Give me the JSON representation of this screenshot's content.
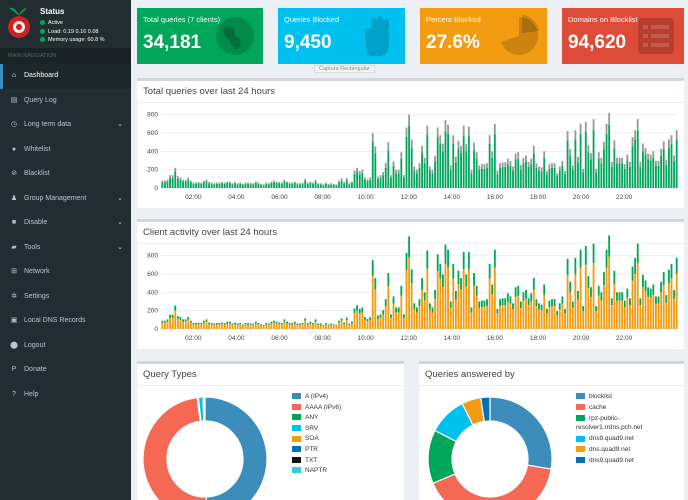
{
  "sidebar": {
    "status": {
      "title": "Status",
      "active": "Active",
      "load": "Load:  0.19  0.16  0.08",
      "memory": "Memory usage:  60.8 %"
    },
    "nav_header": "MAIN NAVIGATION",
    "items": [
      {
        "label": "Dashboard",
        "icon": "home-icon",
        "glyph": "⌂",
        "active": true,
        "chev": false
      },
      {
        "label": "Query Log",
        "icon": "file-icon",
        "glyph": "▤",
        "chev": false
      },
      {
        "label": "Long term data",
        "icon": "clock-icon",
        "glyph": "◷",
        "chev": true
      },
      {
        "label": "Whitelist",
        "icon": "check-circle-icon",
        "glyph": "●",
        "chev": false
      },
      {
        "label": "Blacklist",
        "icon": "ban-icon",
        "glyph": "⊘",
        "chev": false
      },
      {
        "label": "Group Management",
        "icon": "users-icon",
        "glyph": "♟",
        "chev": true
      },
      {
        "label": "Disable",
        "icon": "stop-icon",
        "glyph": "■",
        "chev": true
      },
      {
        "label": "Tools",
        "icon": "folder-icon",
        "glyph": "▰",
        "chev": true
      },
      {
        "label": "Network",
        "icon": "network-icon",
        "glyph": "⊞",
        "chev": false
      },
      {
        "label": "Settings",
        "icon": "gears-icon",
        "glyph": "✲",
        "chev": false
      },
      {
        "label": "Local DNS Records",
        "icon": "address-book-icon",
        "glyph": "▣",
        "chev": false
      },
      {
        "label": "Logout",
        "icon": "user-icon",
        "glyph": "⬤",
        "chev": false
      },
      {
        "label": "Donate",
        "icon": "paypal-icon",
        "glyph": "P",
        "chev": false
      },
      {
        "label": "Help",
        "icon": "question-icon",
        "glyph": "?",
        "chev": false
      }
    ],
    "chevron_glyph": "⌄"
  },
  "tiles": [
    {
      "label": "Total queries (7 clients)",
      "value": "34,181",
      "color": "#00a65a",
      "icon": "globe-icon"
    },
    {
      "label": "Queries Blocked",
      "value": "9,450",
      "color": "#00c0ef",
      "icon": "hand-icon"
    },
    {
      "label": "Percent Blocked",
      "value": "27.6%",
      "color": "#f39c12",
      "icon": "pie-chart-icon"
    },
    {
      "label": "Domains on Blocklist",
      "value": "94,620",
      "color": "#dd4b39",
      "icon": "list-icon"
    }
  ],
  "tooltip": "Captura Rectangular",
  "total_queries": {
    "title": "Total queries over last 24 hours",
    "colors": {
      "permitted": "#00a65a",
      "blocked": "#999999"
    }
  },
  "client_activity": {
    "title": "Client activity over last 24 hours",
    "colors": [
      "#f39c12",
      "#00a65a",
      "#dd4b39",
      "#3c8dbc",
      "#00c0ef",
      "#111111"
    ]
  },
  "query_types": {
    "title": "Query Types",
    "legend": [
      {
        "label": "A (IPv4)",
        "color": "#3c8dbc"
      },
      {
        "label": "AAAA (IPv6)",
        "color": "#f56954"
      },
      {
        "label": "ANY",
        "color": "#00a65a"
      },
      {
        "label": "SRV",
        "color": "#00c0ef"
      },
      {
        "label": "SOA",
        "color": "#f39c12"
      },
      {
        "label": "PTR",
        "color": "#0073b7"
      },
      {
        "label": "TXT",
        "color": "#111111"
      },
      {
        "label": "NAPTR",
        "color": "#39cccc"
      }
    ]
  },
  "queries_answered": {
    "title": "Queries answered by",
    "legend": [
      {
        "label": "blocklist",
        "color": "#3c8dbc"
      },
      {
        "label": "cache",
        "color": "#f56954"
      },
      {
        "label": "rpz-public-resolver1.rrdns.pch.net",
        "color": "#00a65a"
      },
      {
        "label": "dns9.quad9.net",
        "color": "#00c0ef"
      },
      {
        "label": "dns.quad9.net",
        "color": "#f39c12"
      },
      {
        "label": "dns9.quad9.net",
        "color": "#0073b7"
      }
    ]
  },
  "chart_data": [
    {
      "type": "bar",
      "title": "Total queries over last 24 hours",
      "x_tick_labels": [
        "02:00",
        "04:00",
        "06:00",
        "08:00",
        "10:00",
        "12:00",
        "14:00",
        "16:00",
        "18:00",
        "20:00",
        "22:00"
      ],
      "y_ticks": [
        0,
        200,
        400,
        600,
        800
      ],
      "ylim": [
        0,
        850
      ],
      "grid": true,
      "stacked": true,
      "series": [
        {
          "values": [
            60,
            60,
            70,
            110,
            110,
            180,
            100,
            90,
            70,
            70,
            90,
            60,
            45,
            45,
            50,
            45,
            60,
            70,
            50,
            45,
            40,
            45,
            45,
            50,
            45,
            55,
            55,
            40,
            50,
            40,
            45,
            35,
            45,
            45,
            40,
            40,
            55,
            45,
            35,
            30,
            45,
            40,
            55,
            60,
            55,
            50,
            45,
            70,
            55,
            45,
            45,
            55,
            40,
            40,
            45,
            80,
            45,
            55,
            45,
            70,
            40,
            40,
            30,
            45,
            35,
            40,
            35,
            30,
            60,
            80,
            50,
            85,
            40,
            55,
            155,
            180,
            150,
            160,
            90,
            75,
            90,
            510,
            380,
            100,
            110,
            140,
            220,
            410,
            110,
            240,
            160,
            160,
            320,
            110,
            560,
            680,
            440,
            190,
            160,
            220,
            380,
            270,
            580,
            190,
            160,
            290,
            550,
            480,
            400,
            620,
            590,
            200,
            480,
            280,
            430,
            380,
            570,
            400,
            570,
            160,
            410,
            320,
            200,
            210,
            210,
            220,
            480,
            330,
            590,
            150,
            220,
            230,
            230,
            260,
            240,
            190,
            310,
            320,
            200,
            270,
            290,
            230,
            260,
            380,
            220,
            190,
            180,
            330,
            150,
            210,
            220,
            220,
            130,
            190,
            240,
            150,
            520,
            350,
            200,
            530,
            280,
            590,
            170,
            610,
            390,
            310,
            630,
            170,
            320,
            270,
            420,
            590,
            690,
            230,
            430,
            270,
            270,
            270,
            210,
            300,
            230,
            460,
            530,
            630,
            230,
            400,
            360,
            310,
            300,
            330,
            240,
            240,
            350,
            420,
            250,
            440,
            480,
            290,
            530
          ]
        },
        {
          "values": [
            20,
            20,
            20,
            30,
            30,
            40,
            30,
            25,
            20,
            20,
            25,
            20,
            15,
            15,
            15,
            15,
            20,
            20,
            15,
            15,
            12,
            15,
            15,
            15,
            15,
            15,
            15,
            12,
            15,
            12,
            15,
            10,
            15,
            15,
            12,
            12,
            15,
            15,
            10,
            10,
            15,
            12,
            15,
            20,
            15,
            15,
            15,
            20,
            15,
            15,
            15,
            15,
            12,
            12,
            15,
            20,
            15,
            15,
            15,
            20,
            12,
            12,
            10,
            15,
            10,
            12,
            10,
            10,
            20,
            25,
            15,
            25,
            12,
            15,
            35,
            40,
            35,
            40,
            25,
            20,
            25,
            90,
            75,
            25,
            30,
            35,
            50,
            90,
            30,
            50,
            40,
            40,
            70,
            30,
            100,
            120,
            90,
            45,
            40,
            50,
            80,
            60,
            100,
            45,
            40,
            60,
            110,
            95,
            85,
            120,
            100,
            50,
            95,
            60,
            85,
            80,
            110,
            80,
            100,
            40,
            85,
            70,
            45,
            50,
            50,
            50,
            95,
            70,
            110,
            40,
            50,
            50,
            50,
            60,
            55,
            45,
            65,
            70,
            50,
            60,
            65,
            55,
            60,
            80,
            50,
            45,
            45,
            70,
            35,
            50,
            50,
            50,
            30,
            45,
            55,
            35,
            100,
            75,
            45,
            100,
            60,
            110,
            40,
            110,
            80,
            70,
            120,
            40,
            70,
            60,
            85,
            110,
            130,
            55,
            90,
            60,
            60,
            60,
            50,
            65,
            55,
            95,
            100,
            120,
            55,
            85,
            75,
            65,
            65,
            70,
            55,
            55,
            75,
            90,
            55,
            90,
            95,
            65,
            100
          ]
        }
      ]
    },
    {
      "type": "bar",
      "title": "Client activity over last 24 hours",
      "x_tick_labels": [
        "02:00",
        "04:00",
        "06:00",
        "08:00",
        "10:00",
        "12:00",
        "14:00",
        "16:00",
        "18:00",
        "20:00",
        "22:00"
      ],
      "y_ticks": [
        0,
        200,
        400,
        600,
        800
      ],
      "ylim": [
        0,
        850
      ],
      "grid": true,
      "stacked": true,
      "series": [
        {
          "values": [
            70,
            70,
            80,
            120,
            120,
            200,
            110,
            100,
            80,
            80,
            100,
            70,
            50,
            50,
            55,
            50,
            70,
            80,
            55,
            50,
            45,
            50,
            50,
            55,
            50,
            60,
            60,
            45,
            55,
            45,
            50,
            40,
            50,
            50,
            45,
            45,
            60,
            50,
            40,
            35,
            50,
            45,
            60,
            70,
            60,
            55,
            50,
            80,
            60,
            50,
            50,
            60,
            45,
            45,
            50,
            90,
            50,
            60,
            50,
            80,
            45,
            45,
            35,
            50,
            40,
            45,
            40,
            35,
            70,
            90,
            55,
            95,
            45,
            60,
            175,
            200,
            170,
            180,
            100,
            85,
            100,
            580,
            430,
            110,
            125,
            160,
            250,
            470,
            125,
            275,
            180,
            180,
            365,
            125,
            640,
            780,
            500,
            215,
            180,
            250,
            430,
            310,
            660,
            215,
            180,
            330,
            630,
            550,
            460,
            710,
            670,
            230,
            550,
            320,
            490,
            430,
            650,
            460,
            650,
            180,
            470,
            365,
            230,
            240,
            240,
            250,
            550,
            375,
            670,
            170,
            250,
            260,
            260,
            300,
            275,
            215,
            350,
            365,
            230,
            310,
            330,
            260,
            300,
            430,
            250,
            215,
            205,
            375,
            170,
            240,
            250,
            250,
            150,
            215,
            275,
            170,
            590,
            400,
            230,
            600,
            320,
            670,
            195,
            700,
            445,
            350,
            720,
            195,
            365,
            310,
            480,
            670,
            790,
            260,
            490,
            310,
            310,
            310,
            240,
            340,
            260,
            525,
            600,
            720,
            260,
            455,
            410,
            350,
            340,
            375,
            275,
            275,
            400,
            480,
            285,
            500,
            550,
            330,
            600
          ]
        },
        {
          "values": [
            20,
            20,
            25,
            35,
            35,
            55,
            30,
            30,
            25,
            25,
            30,
            20,
            15,
            15,
            15,
            15,
            20,
            25,
            15,
            15,
            15,
            15,
            15,
            15,
            15,
            20,
            20,
            15,
            15,
            15,
            15,
            10,
            15,
            15,
            15,
            15,
            20,
            15,
            10,
            10,
            15,
            15,
            20,
            20,
            20,
            15,
            15,
            25,
            20,
            15,
            15,
            20,
            15,
            15,
            15,
            25,
            15,
            20,
            15,
            25,
            15,
            15,
            10,
            15,
            10,
            15,
            10,
            10,
            20,
            25,
            15,
            30,
            15,
            20,
            50,
            60,
            50,
            55,
            30,
            25,
            30,
            170,
            125,
            35,
            35,
            45,
            75,
            140,
            35,
            80,
            55,
            55,
            105,
            35,
            190,
            230,
            150,
            65,
            55,
            75,
            125,
            90,
            195,
            65,
            55,
            95,
            185,
            160,
            135,
            210,
            195,
            70,
            160,
            95,
            145,
            125,
            190,
            135,
            190,
            55,
            140,
            105,
            70,
            70,
            70,
            75,
            160,
            110,
            195,
            50,
            75,
            75,
            75,
            90,
            80,
            65,
            105,
            105,
            70,
            90,
            95,
            75,
            90,
            125,
            75,
            65,
            60,
            110,
            50,
            70,
            75,
            75,
            45,
            65,
            80,
            50,
            175,
            115,
            70,
            175,
            95,
            195,
            55,
            205,
            130,
            105,
            210,
            55,
            105,
            90,
            140,
            195,
            230,
            75,
            145,
            90,
            90,
            90,
            70,
            100,
            75,
            155,
            175,
            210,
            75,
            135,
            120,
            105,
            100,
            110,
            80,
            80,
            115,
            140,
            85,
            145,
            160,
            95,
            175
          ]
        }
      ]
    },
    {
      "type": "pie",
      "title": "Query Types",
      "labels": [
        "A (IPv4)",
        "AAAA (IPv6)",
        "ANY",
        "SRV",
        "SOA",
        "PTR",
        "TXT",
        "NAPTR"
      ],
      "values": [
        49.5,
        48.5,
        0.3,
        1.2,
        0.2,
        0.2,
        0.05,
        0.05
      ]
    },
    {
      "type": "pie",
      "title": "Queries answered by",
      "labels": [
        "blocklist",
        "cache",
        "rpz-public-resolver1.rrdns.pch.net",
        "dns9.quad9.net",
        "dns.quad9.net",
        "dns9.quad9.net"
      ],
      "values": [
        27.6,
        41,
        14,
        10,
        5,
        2.4
      ]
    }
  ]
}
